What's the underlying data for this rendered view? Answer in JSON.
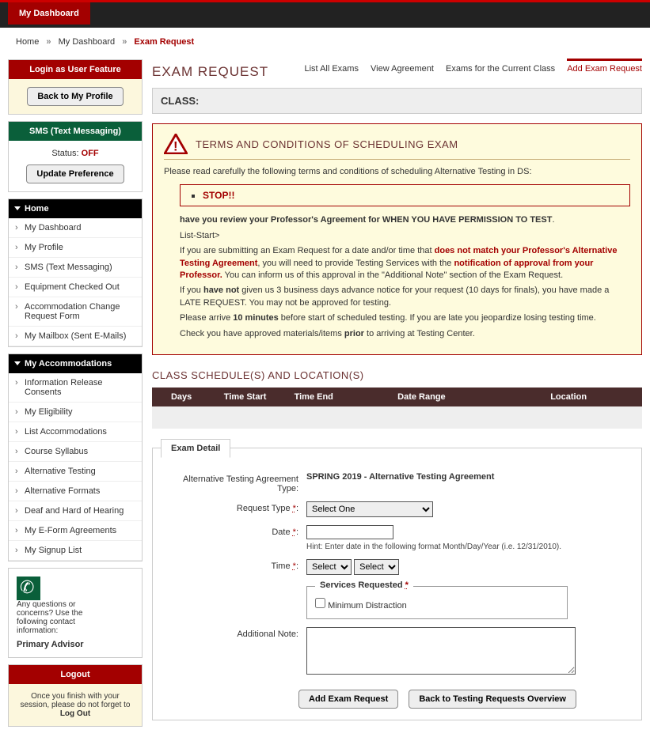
{
  "top_tab": "My Dashboard",
  "breadcrumb": {
    "home": "Home",
    "dash": "My Dashboard",
    "current": "Exam Request"
  },
  "login_feature": {
    "title": "Login as User Feature",
    "button": "Back to My Profile"
  },
  "sms": {
    "title": "SMS (Text Messaging)",
    "status_label": "Status:",
    "status_value": "OFF",
    "button": "Update Preference"
  },
  "home_nav": {
    "title": "Home",
    "items": [
      "My Dashboard",
      "My Profile",
      "SMS (Text Messaging)",
      "Equipment Checked Out",
      "Accommodation Change Request Form",
      "My Mailbox (Sent E-Mails)"
    ]
  },
  "accom_nav": {
    "title": "My Accommodations",
    "items": [
      "Information Release Consents",
      "My Eligibility",
      "List Accommodations",
      "Course Syllabus",
      "Alternative Testing",
      "Alternative Formats",
      "Deaf and Hard of Hearing",
      "My E-Form Agreements",
      "My Signup List"
    ]
  },
  "contact": {
    "q": "Any questions or concerns? Use the following contact information:",
    "advisor": "Primary Advisor"
  },
  "logout": {
    "title": "Logout",
    "msg": "Once you finish with your session, please do not forget to ",
    "bold": "Log Out"
  },
  "page": {
    "title": "EXAM REQUEST",
    "tabs": [
      "List All Exams",
      "View Agreement",
      "Exams for the Current Class",
      "Add Exam Request"
    ],
    "class_head": "CLASS:"
  },
  "alert": {
    "title": "TERMS AND CONDITIONS OF SCHEDULING EXAM",
    "intro": "Please read carefully the following terms and conditions of scheduling Alternative Testing in DS:",
    "stop": "STOP!!",
    "line_review_a": "have you review your Professor's Agreement for ",
    "line_review_b": "WHEN YOU HAVE PERMISSION TO TEST",
    "list_start": "List-Start>",
    "p2a": "If you are submitting an Exam Request for a date and/or time that ",
    "p2b": "does not match your Professor's Alternative Testing Agreement",
    "p2c": ", you will need to provide Testing Services with the ",
    "p2d": "notification of approval from your Professor.",
    "p2e": " You can inform us of this approval in the \"Additional Note\" section of the Exam Request.",
    "p3a": "If you ",
    "p3b": "have not",
    "p3c": " given us 3 business days advance notice for your request (10 days for finals), you have made a LATE REQUEST. You may not be approved for testing.",
    "p4a": "Please arrive ",
    "p4b": "10 minutes",
    "p4c": " before start of scheduled testing. If you are late you jeopardize losing testing time.",
    "p5a": "Check you have approved materials/items ",
    "p5b": "prior",
    "p5c": " to arriving at Testing Center."
  },
  "sched": {
    "title": "CLASS SCHEDULE(S) AND LOCATION(S)",
    "cols": [
      "Days",
      "Time Start",
      "Time End",
      "Date Range",
      "Location"
    ]
  },
  "detail": {
    "tab": "Exam Detail",
    "agr_label": "Alternative Testing Agreement Type:",
    "agr_value": "SPRING 2019 - Alternative Testing Agreement",
    "req_type_label": "Request Type",
    "req_type_sel": "Select One",
    "date_label": "Date",
    "date_hint": "Hint: Enter date in the following format Month/Day/Year (i.e. 12/31/2010).",
    "time_label": "Time",
    "time_sel": "Select",
    "services_title": "Services Requested",
    "service1": "Minimum Distraction",
    "note_label": "Additional Note:",
    "btn_add": "Add Exam Request",
    "btn_back": "Back to Testing Requests Overview"
  }
}
